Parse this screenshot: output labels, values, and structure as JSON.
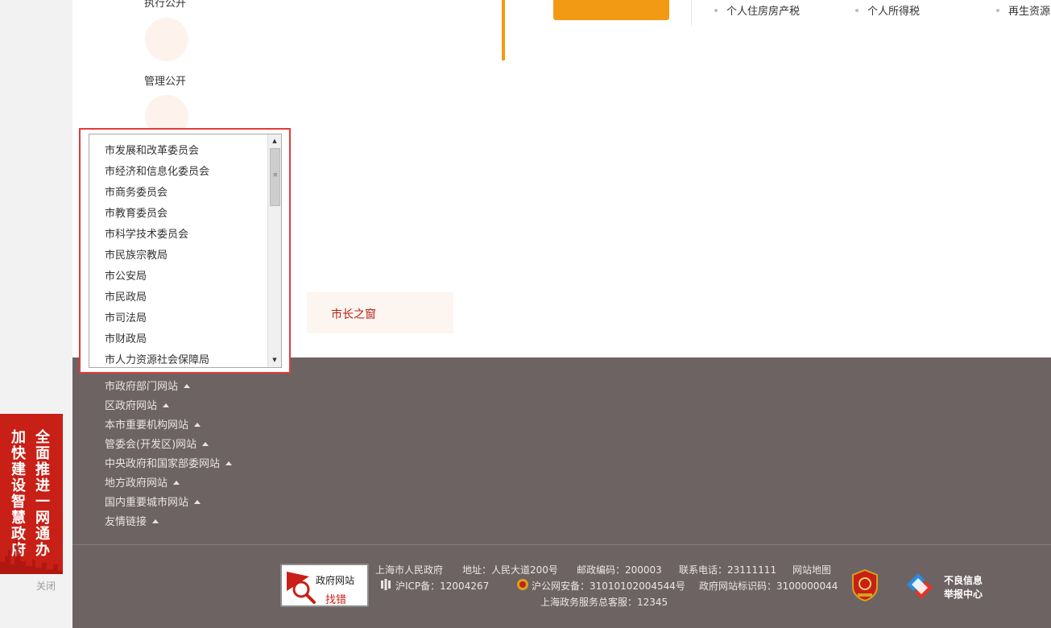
{
  "side_nav": {
    "top_label": "执行公开",
    "manage_label": "管理公开"
  },
  "tax_links": [
    "个人住房房产税",
    "个人所得税",
    "再生资源"
  ],
  "mayor": {
    "label": "市长之窗"
  },
  "dropdown": {
    "items": [
      "市发展和改革委员会",
      "市经济和信息化委员会",
      "市商务委员会",
      "市教育委员会",
      "市科学技术委员会",
      "市民族宗教局",
      "市公安局",
      "市民政局",
      "市司法局",
      "市财政局",
      "市人力资源社会保障局"
    ]
  },
  "footer_links": [
    "市政府部门网站",
    "区政府网站",
    "本市重要机构网站",
    "管委会(开发区)网站",
    "中央政府和国家部委网站",
    "地方政府网站",
    "国内重要城市网站",
    "友情链接"
  ],
  "banner": {
    "col_right": "全面推进一网通办",
    "col_left": "加快建设智慧政府",
    "close": "关闭"
  },
  "finder": {
    "line1": "政府网站",
    "line2": "找错"
  },
  "info": {
    "org": "上海市人民政府",
    "address": "地址：人民大道200号",
    "postcode": "邮政编码：200003",
    "phone": "联系电话：23111111",
    "sitemap": "网站地图",
    "icp": "沪ICP备：12004267",
    "security": "沪公网安备：31010102004544号",
    "site_id": "政府网站标识码：3100000044",
    "service": "上海政务服务总客服：12345"
  },
  "report": {
    "line1": "不良信息",
    "line2": "举报中心"
  },
  "colors": {
    "accent_orange": "#f39a14",
    "brand_red": "#c81f16",
    "footer_bg": "#6d6363",
    "highlight_border": "#e33b3b"
  }
}
